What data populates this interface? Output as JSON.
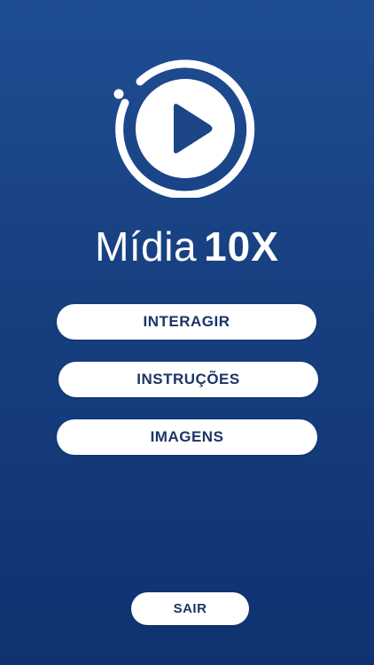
{
  "app": {
    "brand_light": "Mídia",
    "brand_bold": "10X"
  },
  "colors": {
    "background_top": "#1f4d92",
    "background_bottom": "#0f3270",
    "button_bg": "#ffffff",
    "button_text": "#1b3566",
    "logo": "#ffffff",
    "play_triangle": "#1c4587"
  },
  "icons": {
    "logo": "play-circle-icon"
  },
  "menu": {
    "interagir_label": "INTERAGIR",
    "instrucoes_label": "INSTRUÇÕES",
    "imagens_label": "IMAGENS",
    "sair_label": "SAIR"
  }
}
